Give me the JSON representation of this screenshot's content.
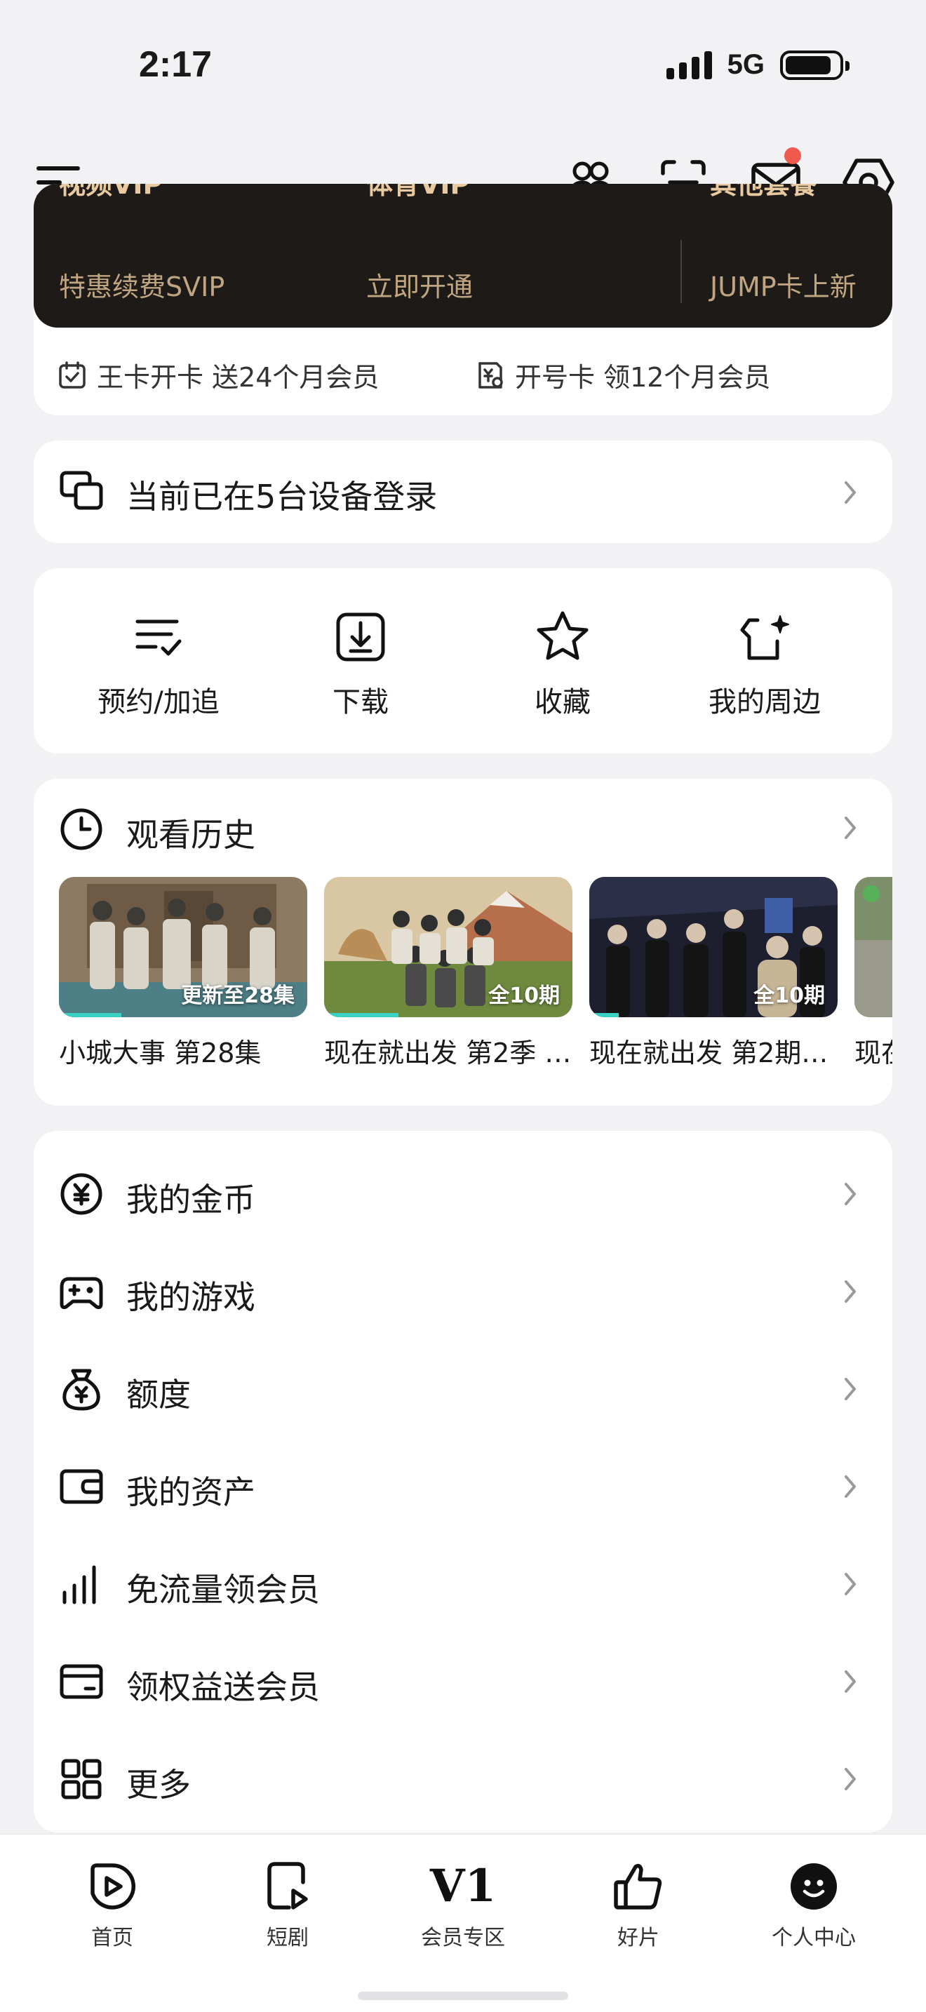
{
  "status_bar": {
    "time": "2:17",
    "network": "5G"
  },
  "vip": {
    "items": [
      {
        "title": "视频VIP",
        "subtitle": "特惠续费SVIP"
      },
      {
        "title": "体育VIP",
        "subtitle": "立即开通"
      },
      {
        "title": "其他套餐",
        "subtitle": "JUMP卡上新"
      }
    ],
    "promos": [
      {
        "text": "王卡开卡 送24个月会员",
        "icon": "calendar-check-icon"
      },
      {
        "text": "开号卡 领12个月会员",
        "icon": "yuan-card-icon"
      }
    ]
  },
  "device_login": {
    "text": "当前已在5台设备登录"
  },
  "quick_actions": [
    {
      "label": "预约/加追",
      "icon": "list-check-icon"
    },
    {
      "label": "下载",
      "icon": "download-icon"
    },
    {
      "label": "收藏",
      "icon": "star-icon"
    },
    {
      "label": "我的周边",
      "icon": "merch-icon"
    }
  ],
  "history": {
    "title": "观看历史",
    "items": [
      {
        "title": "小城大事 第28集",
        "badge": "更新至28集",
        "progress": 0.25
      },
      {
        "title": "现在就出发 第2季 …",
        "badge": "全10期",
        "progress": 0.3
      },
      {
        "title": "现在就出发 第2期…",
        "badge": "全10期",
        "progress": 0.12
      },
      {
        "title": "现在",
        "badge": "",
        "progress": 0
      }
    ]
  },
  "menu": [
    {
      "label": "我的金币",
      "icon": "coin-icon"
    },
    {
      "label": "我的游戏",
      "icon": "gamepad-icon"
    },
    {
      "label": "额度",
      "icon": "money-bag-icon"
    },
    {
      "label": "我的资产",
      "icon": "wallet-icon"
    },
    {
      "label": "免流量领会员",
      "icon": "signal-bars-icon"
    },
    {
      "label": "领权益送会员",
      "icon": "card-icon"
    },
    {
      "label": "更多",
      "icon": "grid-icon"
    }
  ],
  "tabs": [
    {
      "label": "首页",
      "icon": "play-icon"
    },
    {
      "label": "短剧",
      "icon": "short-drama-icon"
    },
    {
      "label": "会员专区",
      "icon_text": "V1"
    },
    {
      "label": "好片",
      "icon": "thumbs-up-icon"
    },
    {
      "label": "个人中心",
      "icon": "profile-icon",
      "active": true
    }
  ],
  "colors": {
    "accent_gold": "#e8c9a0",
    "vip_band": "#1d1a17",
    "unread": "#f05a4e",
    "progress": "#39d1c3"
  }
}
